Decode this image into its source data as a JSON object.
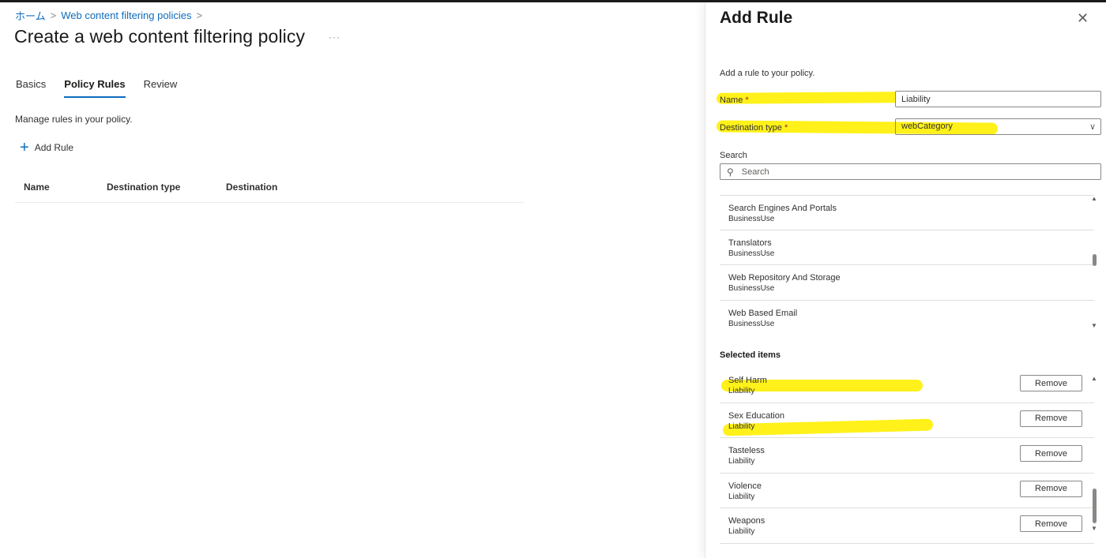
{
  "breadcrumb": {
    "home": "ホーム",
    "parent": "Web content filtering policies",
    "sep": ">"
  },
  "page": {
    "title": "Create a web content filtering policy",
    "more": "···",
    "tabs": [
      "Basics",
      "Policy Rules",
      "Review"
    ],
    "active_tab": "Policy Rules",
    "manage_text": "Manage rules in your policy.",
    "add_rule_label": "Add Rule",
    "columns": [
      "Name",
      "Destination type",
      "Destination"
    ]
  },
  "panel": {
    "title": "Add Rule",
    "close": "✕",
    "description": "Add a rule to your policy.",
    "name_label": "Name",
    "name_value": "Liability",
    "dest_type_label": "Destination type",
    "dest_type_value": "webCategory",
    "required_mark": "*",
    "search_label": "Search",
    "search_placeholder": "Search",
    "available": [
      {
        "name": "Search Engines And Portals",
        "group": "BusinessUse"
      },
      {
        "name": "Translators",
        "group": "BusinessUse"
      },
      {
        "name": "Web Repository And Storage",
        "group": "BusinessUse"
      },
      {
        "name": "Web Based Email",
        "group": "BusinessUse"
      }
    ],
    "selected_heading": "Selected items",
    "remove_label": "Remove",
    "selected": [
      {
        "name": "Self Harm",
        "group": "Liability"
      },
      {
        "name": "Sex Education",
        "group": "Liability"
      },
      {
        "name": "Tasteless",
        "group": "Liability"
      },
      {
        "name": "Violence",
        "group": "Liability"
      },
      {
        "name": "Weapons",
        "group": "Liability"
      }
    ]
  },
  "colors": {
    "accent": "#0f6cbd",
    "highlight": "#ffef00"
  }
}
